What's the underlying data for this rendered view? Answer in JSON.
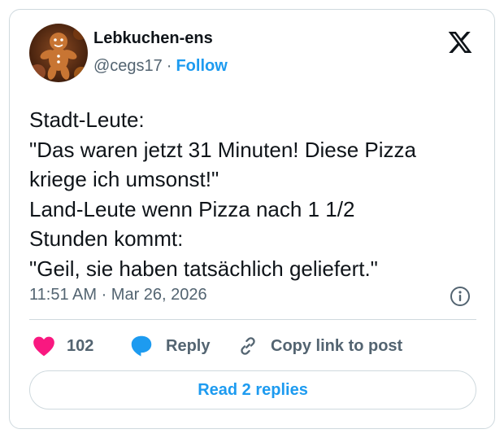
{
  "author": {
    "name": "Lebkuchen-ens",
    "handle": "@cegs17",
    "separator": "·",
    "follow_label": "Follow",
    "avatar_icon": "gingerbread-man-avatar"
  },
  "tweet": {
    "lines": [
      "Stadt-Leute:",
      "\"Das waren jetzt 31 Minuten! Diese Pizza",
      "kriege ich umsonst!\"",
      "Land-Leute wenn Pizza nach 1 1/2",
      "Stunden kommt:",
      "\"Geil, sie haben tatsächlich geliefert.\""
    ],
    "timestamp": "11:51 AM · Mar 26, 2026"
  },
  "actions": {
    "like_count": "102",
    "reply_label": "Reply",
    "copy_label": "Copy link to post"
  },
  "read_replies_label": "Read 2 replies",
  "icons": {
    "logo": "x-logo-icon",
    "info": "info-icon",
    "like": "heart-icon",
    "reply": "speech-bubble-icon",
    "copy": "link-icon"
  },
  "colors": {
    "accent": "#1d9bf0",
    "like": "#f91880",
    "text": "#0f1419",
    "muted": "#536471",
    "border": "#cfd9de"
  }
}
